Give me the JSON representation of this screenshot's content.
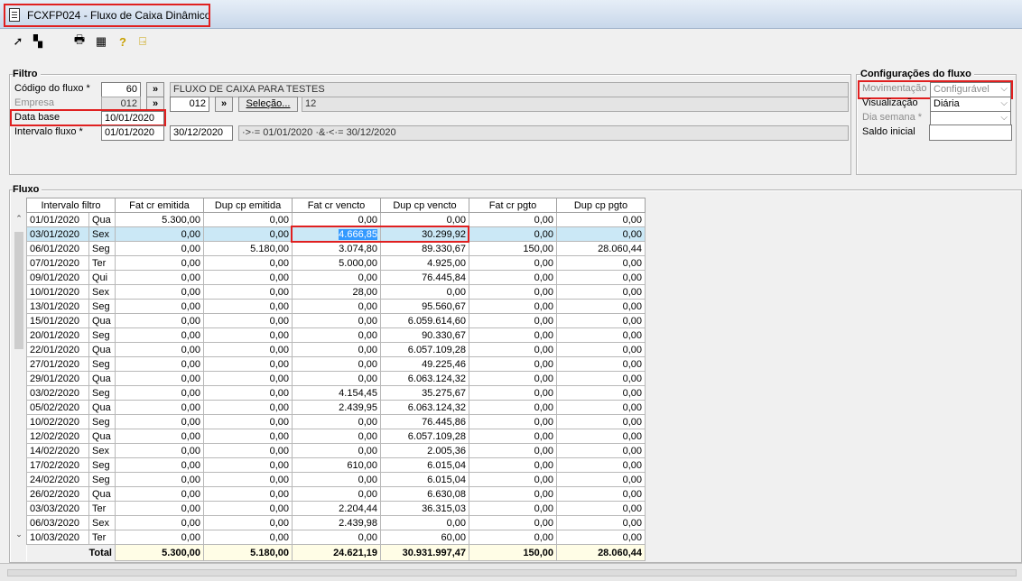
{
  "window": {
    "title": "FCXFP024 - Fluxo de Caixa Dinâmico"
  },
  "toolbar": [
    {
      "name": "execute-icon",
      "glyph": "➚"
    },
    {
      "name": "export-icon",
      "glyph": "▚"
    },
    {
      "name": "print-icon",
      "glyph": "🖶"
    },
    {
      "name": "calculator-icon",
      "glyph": "▦"
    },
    {
      "name": "help-icon",
      "glyph": "?"
    },
    {
      "name": "exit-door-icon",
      "glyph": "⍈"
    }
  ],
  "filtro": {
    "title": "Filtro",
    "codigo_label": "Código do fluxo *",
    "codigo_value": "60",
    "lookup_btn": "»",
    "fluxo_desc": "FLUXO DE CAIXA PARA TESTES",
    "empresa_label": "Empresa",
    "empresa_value": "012",
    "empresa2_value": "012",
    "selecao_btn": "Seleção...",
    "selecao_count": "12",
    "data_base_label": "Data base",
    "data_base_value": "10/01/2020",
    "intervalo_label": "Intervalo fluxo *",
    "intervalo_de": "01/01/2020",
    "intervalo_ate": "30/12/2020",
    "intervalo_expr": "·>·= 01/01/2020 ·&·<·= 30/12/2020"
  },
  "config": {
    "title": "Configurações do fluxo",
    "movimentacao_label": "Movimentação",
    "movimentacao_value": "Configurável",
    "visualizacao_label": "Visualização",
    "visualizacao_value": "Diária",
    "dia_semana_label": "Dia semana *",
    "dia_semana_value": "",
    "saldo_label": "Saldo inicial",
    "saldo_value": ""
  },
  "fluxo": {
    "title": "Fluxo",
    "columns": [
      "Intervalo filtro",
      "Fat cr emitida",
      "Dup cp emitida",
      "Fat cr vencto",
      "Dup cp vencto",
      "Fat cr pgto",
      "Dup cp pgto"
    ],
    "rows": [
      [
        "01/01/2020",
        "Qua",
        "5.300,00",
        "0,00",
        "0,00",
        "0,00",
        "0,00",
        "0,00"
      ],
      [
        "03/01/2020",
        "Sex",
        "0,00",
        "0,00",
        "4.666,85",
        "30.299,92",
        "0,00",
        "0,00"
      ],
      [
        "06/01/2020",
        "Seg",
        "0,00",
        "5.180,00",
        "3.074,80",
        "89.330,67",
        "150,00",
        "28.060,44"
      ],
      [
        "07/01/2020",
        "Ter",
        "0,00",
        "0,00",
        "5.000,00",
        "4.925,00",
        "0,00",
        "0,00"
      ],
      [
        "09/01/2020",
        "Qui",
        "0,00",
        "0,00",
        "0,00",
        "76.445,84",
        "0,00",
        "0,00"
      ],
      [
        "10/01/2020",
        "Sex",
        "0,00",
        "0,00",
        "28,00",
        "0,00",
        "0,00",
        "0,00"
      ],
      [
        "13/01/2020",
        "Seg",
        "0,00",
        "0,00",
        "0,00",
        "95.560,67",
        "0,00",
        "0,00"
      ],
      [
        "15/01/2020",
        "Qua",
        "0,00",
        "0,00",
        "0,00",
        "6.059.614,60",
        "0,00",
        "0,00"
      ],
      [
        "20/01/2020",
        "Seg",
        "0,00",
        "0,00",
        "0,00",
        "90.330,67",
        "0,00",
        "0,00"
      ],
      [
        "22/01/2020",
        "Qua",
        "0,00",
        "0,00",
        "0,00",
        "6.057.109,28",
        "0,00",
        "0,00"
      ],
      [
        "27/01/2020",
        "Seg",
        "0,00",
        "0,00",
        "0,00",
        "49.225,46",
        "0,00",
        "0,00"
      ],
      [
        "29/01/2020",
        "Qua",
        "0,00",
        "0,00",
        "0,00",
        "6.063.124,32",
        "0,00",
        "0,00"
      ],
      [
        "03/02/2020",
        "Seg",
        "0,00",
        "0,00",
        "4.154,45",
        "35.275,67",
        "0,00",
        "0,00"
      ],
      [
        "05/02/2020",
        "Qua",
        "0,00",
        "0,00",
        "2.439,95",
        "6.063.124,32",
        "0,00",
        "0,00"
      ],
      [
        "10/02/2020",
        "Seg",
        "0,00",
        "0,00",
        "0,00",
        "76.445,86",
        "0,00",
        "0,00"
      ],
      [
        "12/02/2020",
        "Qua",
        "0,00",
        "0,00",
        "0,00",
        "6.057.109,28",
        "0,00",
        "0,00"
      ],
      [
        "14/02/2020",
        "Sex",
        "0,00",
        "0,00",
        "0,00",
        "2.005,36",
        "0,00",
        "0,00"
      ],
      [
        "17/02/2020",
        "Seg",
        "0,00",
        "0,00",
        "610,00",
        "6.015,04",
        "0,00",
        "0,00"
      ],
      [
        "24/02/2020",
        "Seg",
        "0,00",
        "0,00",
        "0,00",
        "6.015,04",
        "0,00",
        "0,00"
      ],
      [
        "26/02/2020",
        "Qua",
        "0,00",
        "0,00",
        "0,00",
        "6.630,08",
        "0,00",
        "0,00"
      ],
      [
        "03/03/2020",
        "Ter",
        "0,00",
        "0,00",
        "2.204,44",
        "36.315,03",
        "0,00",
        "0,00"
      ],
      [
        "06/03/2020",
        "Sex",
        "0,00",
        "0,00",
        "2.439,98",
        "0,00",
        "0,00",
        "0,00"
      ],
      [
        "10/03/2020",
        "Ter",
        "0,00",
        "0,00",
        "0,00",
        "60,00",
        "0,00",
        "0,00"
      ]
    ],
    "total_label": "Total",
    "totals": [
      "5.300,00",
      "5.180,00",
      "24.621,19",
      "30.931.997,47",
      "150,00",
      "28.060,44"
    ],
    "selected_row": 1
  },
  "colors": {
    "highlight": "#e02020",
    "selection": "#cbe8f6",
    "focus": "#3399ff"
  }
}
